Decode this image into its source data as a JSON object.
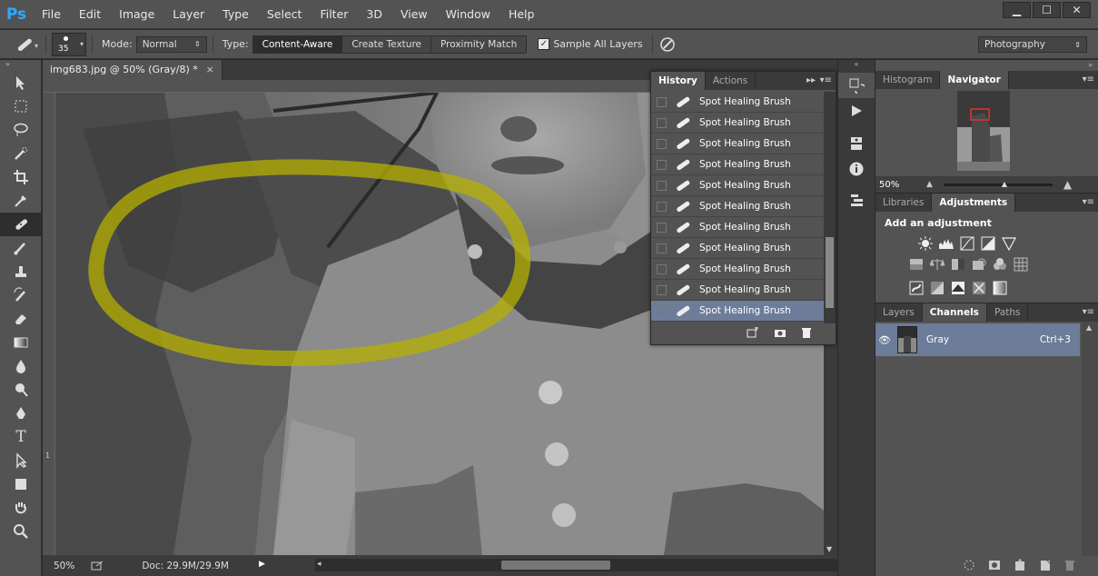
{
  "app": {
    "logo": "Ps"
  },
  "menu": [
    "File",
    "Edit",
    "Image",
    "Layer",
    "Type",
    "Select",
    "Filter",
    "3D",
    "View",
    "Window",
    "Help"
  ],
  "window_controls": {
    "minimize": "▁",
    "maximize": "☐",
    "close": "✕"
  },
  "options": {
    "brush_size": "35",
    "mode_label": "Mode:",
    "mode_value": "Normal",
    "type_label": "Type:",
    "type_buttons": [
      "Content-Aware",
      "Create Texture",
      "Proximity Match"
    ],
    "type_active": "Content-Aware",
    "sample_all_layers": "Sample All Layers",
    "workspace": "Photography"
  },
  "document": {
    "tab_title": "img683.jpg @ 50% (Gray/8) *",
    "tab_close": "×",
    "zoom": "50%",
    "doc_size": "Doc: 29.9M/29.9M",
    "ruler_mark": "1"
  },
  "history": {
    "tabs": [
      "History",
      "Actions"
    ],
    "active_tab": "History",
    "items": [
      "Spot Healing Brush",
      "Spot Healing Brush",
      "Spot Healing Brush",
      "Spot Healing Brush",
      "Spot Healing Brush",
      "Spot Healing Brush",
      "Spot Healing Brush",
      "Spot Healing Brush",
      "Spot Healing Brush",
      "Spot Healing Brush",
      "Spot Healing Brush"
    ]
  },
  "navigator": {
    "tabs": [
      "Histogram",
      "Navigator"
    ],
    "active_tab": "Navigator",
    "zoom": "50%"
  },
  "adjustments": {
    "tabs": [
      "Libraries",
      "Adjustments"
    ],
    "active_tab": "Adjustments",
    "title": "Add an adjustment"
  },
  "channels": {
    "tabs": [
      "Layers",
      "Channels",
      "Paths"
    ],
    "active_tab": "Channels",
    "items": [
      {
        "name": "Gray",
        "shortcut": "Ctrl+3"
      }
    ]
  },
  "colors": {
    "accent_selected": "#6d7d99",
    "highlight_stroke": "#b5b000",
    "ps_blue": "#31a8ff"
  }
}
